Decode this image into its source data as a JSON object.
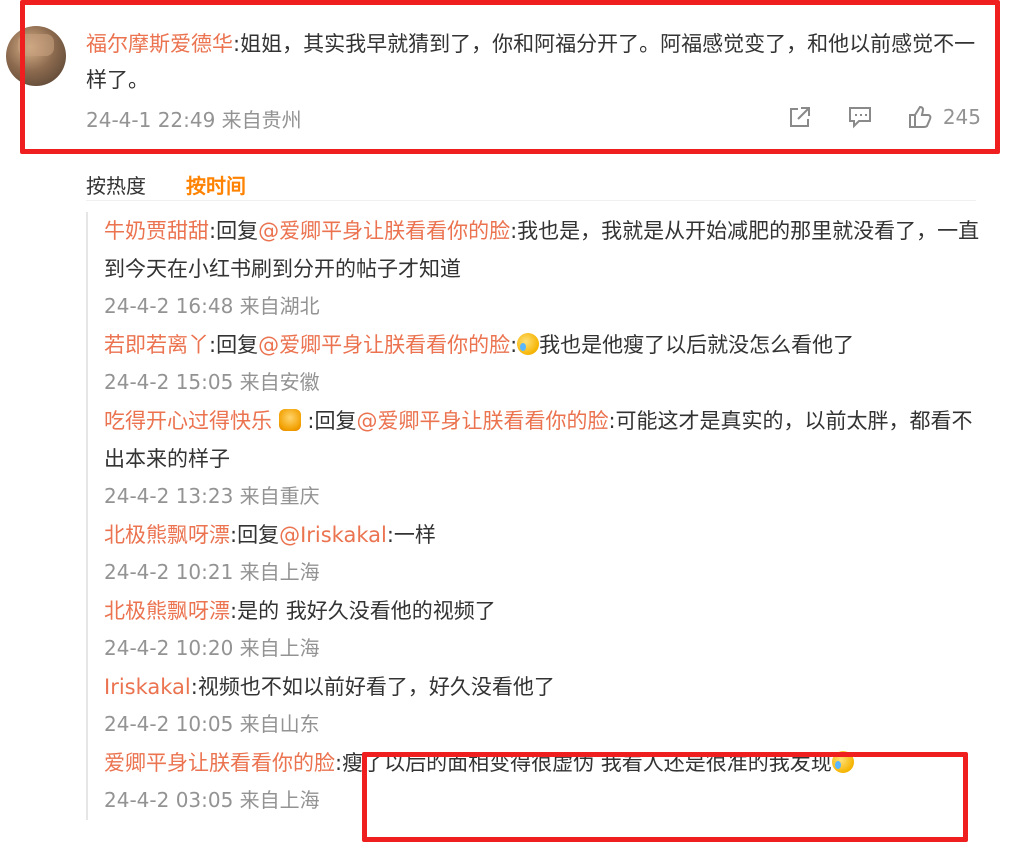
{
  "top_comment": {
    "user": "福尔摩斯爱德华",
    "text": ":姐姐，其实我早就猜到了，你和阿福分开了。阿福感觉变了，和他以前感觉不一样了。",
    "meta": "24-4-1 22:49 来自贵州",
    "likes": "245"
  },
  "sort": {
    "hot": "按热度",
    "time": "按时间"
  },
  "replies": [
    {
      "user": "牛奶贾甜甜",
      "reply_prefix": ":回复",
      "mention": "@爱卿平身让朕看看你的脸",
      "text": ":我也是，我就是从开始减肥的那里就没看了，一直到今天在小红书刷到分开的帖子才知道",
      "meta": "24-4-2 16:48 来自湖北"
    },
    {
      "user": "若即若离丫",
      "reply_prefix": ":回复",
      "mention": "@爱卿平身让朕看看你的脸",
      "text": "我也是他瘦了以后就没怎么看他了",
      "meta": "24-4-2 15:05 来自安徽"
    },
    {
      "user": "吃得开心过得快乐",
      "reply_prefix": ":回复",
      "mention": "@爱卿平身让朕看看你的脸",
      "text": ":可能这才是真实的，以前太胖，都看不出本来的样子",
      "meta": "24-4-2 13:23 来自重庆"
    },
    {
      "user": "北极熊飘呀漂",
      "reply_prefix": ":回复",
      "mention": "@Iriskakal",
      "text": ":一样",
      "meta": "24-4-2 10:21 来自上海"
    },
    {
      "user": "北极熊飘呀漂",
      "text": ":是的 我好久没看他的视频了",
      "meta": "24-4-2 10:20 来自上海"
    },
    {
      "user": "Iriskakal",
      "text": ":视频也不如以前好看了，好久没看他了",
      "meta": "24-4-2 10:05 来自山东"
    },
    {
      "user": "爱卿平身让朕看看你的脸",
      "text": ":瘦了以后的面相变得很虚伪 我看人还是很准的我发现",
      "meta": "24-4-2 03:05 来自上海"
    }
  ],
  "colors": {
    "username": "#eb7350",
    "meta": "#939393",
    "highlight": "#ef1f1f",
    "active_sort": "#ff8200"
  }
}
